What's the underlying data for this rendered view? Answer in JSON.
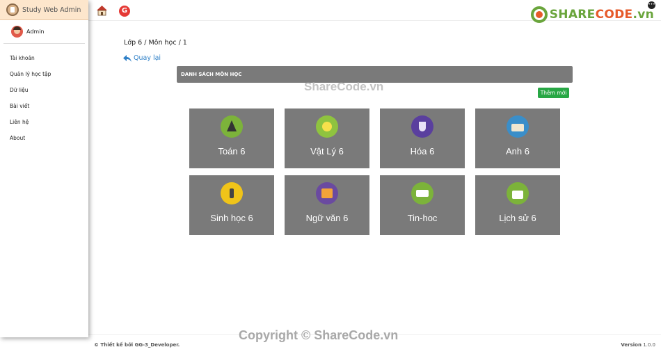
{
  "sidebar": {
    "brand": "Study Web Admin",
    "user": "Admin",
    "items": [
      {
        "label": "Tài khoản"
      },
      {
        "label": "Quản lý học tập"
      },
      {
        "label": "Dữ liệu"
      },
      {
        "label": "Bài viết"
      },
      {
        "label": "Liên hệ"
      },
      {
        "label": "About"
      }
    ]
  },
  "topbar": {
    "logo_prefix": "SHARE",
    "logo_suffix": "CODE",
    "logo_tld": ".vn",
    "logo_menu": "•••",
    "logout_glyph": "G"
  },
  "main": {
    "breadcrumb": "Lớp 6 / Môn học / 1",
    "back_label": "Quay lại",
    "panel_title": "DANH SÁCH MÔN HỌC",
    "add_label": "Thêm mới",
    "subjects": [
      {
        "name": "Toán 6",
        "icon": "compass-icon"
      },
      {
        "name": "Vật Lý 6",
        "icon": "atom-icon"
      },
      {
        "name": "Hóa 6",
        "icon": "flask-icon"
      },
      {
        "name": "Anh 6",
        "icon": "school-icon"
      },
      {
        "name": "Sinh học 6",
        "icon": "microscope-icon"
      },
      {
        "name": "Ngữ văn 6",
        "icon": "books-icon"
      },
      {
        "name": "Tin-hoc",
        "icon": "laptop-icon"
      },
      {
        "name": "Lịch sử 6",
        "icon": "calendar-icon"
      }
    ]
  },
  "footer": {
    "credit": "© Thiết kế bởi GG-3_Developer.",
    "version_label": "Version",
    "version": "1.0.0"
  },
  "watermarks": {
    "center": "ShareCode.vn",
    "bottom": "Copyright © ShareCode.vn"
  },
  "colors": {
    "card": "#7a7a7a",
    "add_button": "#28a745",
    "link": "#2f80c7",
    "brand_bar": "#fde6cc"
  }
}
